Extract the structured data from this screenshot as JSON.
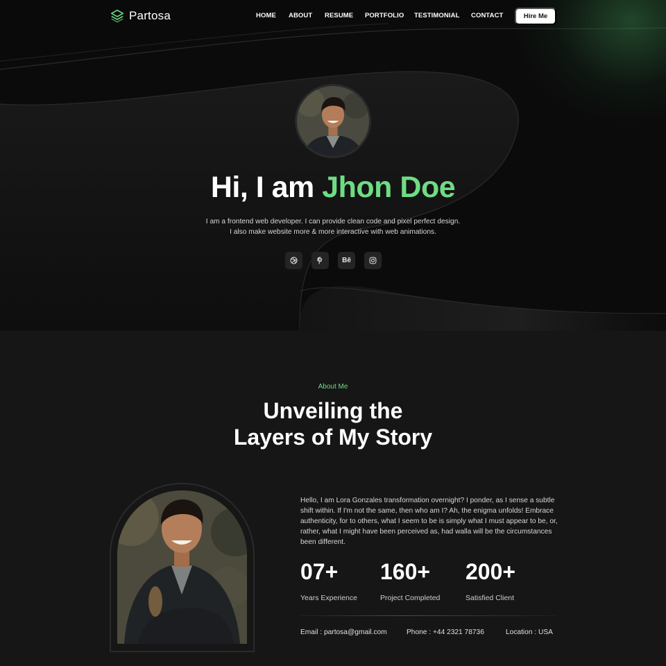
{
  "brand": {
    "name": "Partosa",
    "accent": "#6fdc84"
  },
  "nav": {
    "items": [
      "HOME",
      "ABOUT",
      "RESUME",
      "PORTFOLIO",
      "TESTIMONIAL",
      "CONTACT"
    ],
    "cta": "Hire Me"
  },
  "hero": {
    "greeting": "Hi, I am ",
    "name": "Jhon Doe",
    "desc_line1": "I am a frontend web developer. I can provide clean code and pixel perfect design.",
    "desc_line2": "I also make website more & more interactive with web animations.",
    "socials": [
      {
        "icon": "dribbble-icon",
        "glyph": ""
      },
      {
        "icon": "pinterest-icon",
        "glyph": ""
      },
      {
        "icon": "behance-icon",
        "glyph": "Bē"
      },
      {
        "icon": "instagram-icon",
        "glyph": ""
      }
    ]
  },
  "about": {
    "tag": "About Me",
    "title_line1": "Unveiling the",
    "title_line2": "Layers of My Story",
    "text": "Hello, I am Lora Gonzales transformation overnight? I ponder, as I sense a subtle shift within. If I'm not the same, then who am I? Ah, the enigma unfolds! Embrace authenticity, for to others, what I seem to be is simply what I must appear to be, or, rather, what I might have been perceived as, had walla will be the circumstances been different.",
    "stats": [
      {
        "value": "07+",
        "label": "Years Experience"
      },
      {
        "value": "160+",
        "label": "Project Completed"
      },
      {
        "value": "200+",
        "label": "Satisfied Client"
      }
    ],
    "contact": {
      "email": "Email : partosa@gmail.com",
      "phone": "Phone : +44 2321 78736",
      "location": "Location : USA"
    }
  }
}
